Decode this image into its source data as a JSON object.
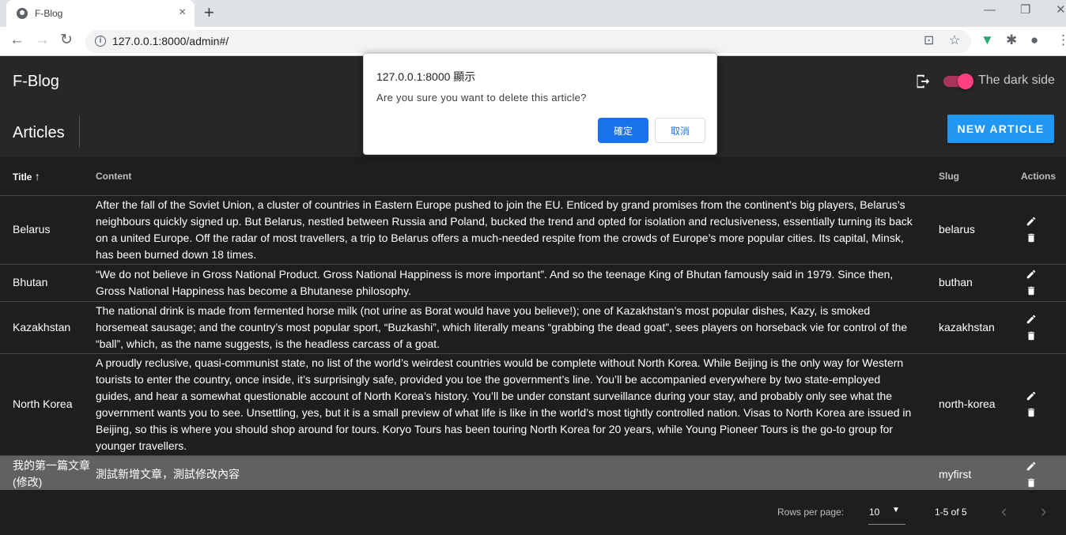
{
  "browser": {
    "tab_title": "F-Blog",
    "url": "127.0.0.1:8000/admin#/",
    "tab_close": "×",
    "new_tab": "+",
    "minimize": "—",
    "restore": "❐",
    "close_window": "✕"
  },
  "app": {
    "title": "F-Blog",
    "dark_side_label": "The dark side",
    "dark_side_on": true,
    "accent_color": "#ff4081"
  },
  "articles": {
    "heading": "Articles",
    "new_button": "NEW ARTICLE",
    "button_color": "#2196f3",
    "columns": {
      "title": "Title",
      "content": "Content",
      "slug": "Slug",
      "actions": "Actions"
    },
    "rows": [
      {
        "title": "Belarus",
        "content": "After the fall of the Soviet Union, a cluster of countries in Eastern Europe pushed to join the EU. Enticed by grand promises from the continent’s big players, Belarus’s neighbours quickly signed up. But Belarus, nestled between Russia and Poland, bucked the trend and opted for isolation and reclusiveness, essentially turning its back on a united Europe. Off the radar of most travellers, a trip to Belarus offers a much-needed respite from the crowds of Europe’s more popular cities. Its capital, Minsk, has been burned down 18 times.",
        "slug": "belarus"
      },
      {
        "title": "Bhutan",
        "content": "“We do not believe in Gross National Product. Gross National Happiness is more important”. And so the teenage King of Bhutan famously said in 1979. Since then, Gross National Happiness has become a Bhutanese philosophy.",
        "slug": "buthan"
      },
      {
        "title": "Kazakhstan",
        "content": "The national drink is made from fermented horse milk (not urine as Borat would have you believe!); one of Kazakhstan’s most popular dishes, Kazy, is smoked horsemeat sausage; and the country’s most popular sport, “Buzkashi”, which literally means “grabbing the dead goat”, sees players on horseback vie for control of the “ball”, which, as the name suggests, is the headless carcass of a goat.",
        "slug": "kazakhstan"
      },
      {
        "title": "North Korea",
        "content": "A proudly reclusive, quasi-communist state, no list of the world’s weirdest countries would be complete without North Korea. While Beijing is the only way for Western tourists to enter the country, once inside, it’s surprisingly safe, provided you toe the government’s line. You’ll be accompanied everywhere by two state-employed guides, and hear a somewhat questionable account of North Korea’s history. You’ll be under constant surveillance during your stay, and probably only see what the government wants you to see. Unsettling, yes, but it is a small preview of what life is like in the world’s most tightly controlled nation. Visas to North Korea are issued in Beijing, so this is where you should shop around for tours. Koryo Tours has been touring North Korea for 20 years, while Young Pioneer Tours is the go-to group for younger travellers.",
        "slug": "north-korea"
      },
      {
        "title": "我的第一篇文章(修改)",
        "content": "測試新增文章，測試修改內容",
        "slug": "myfirst"
      }
    ],
    "footer": {
      "rows_per_page_label": "Rows per page:",
      "rows_per_page_value": "10",
      "page_info": "1-5 of 5"
    }
  },
  "dialog": {
    "origin": "127.0.0.1:8000 顯示",
    "message": "Are you sure you want to delete this article?",
    "ok": "確定",
    "cancel": "取消"
  }
}
